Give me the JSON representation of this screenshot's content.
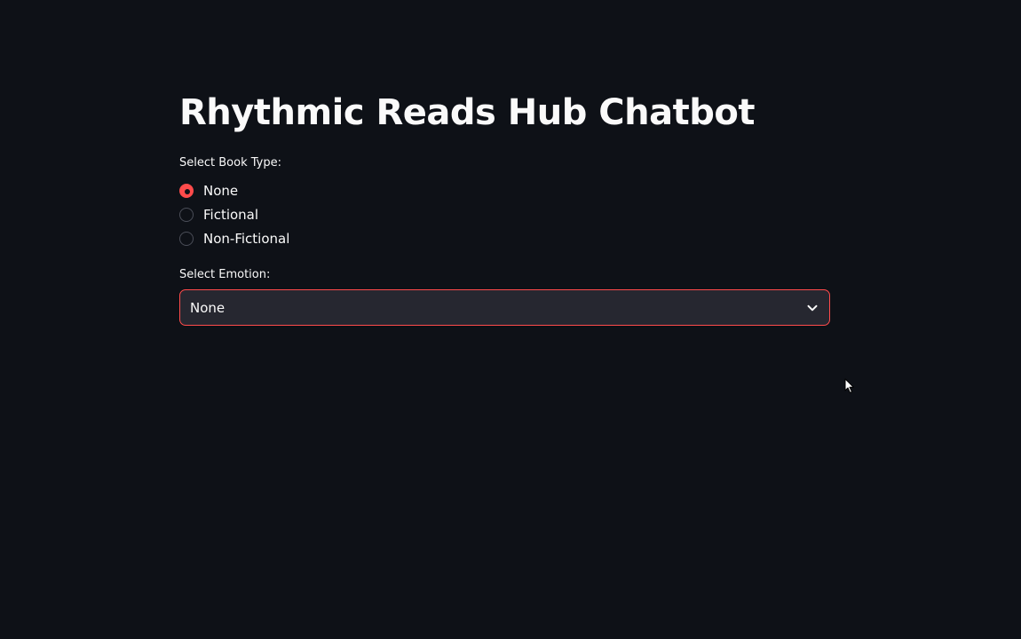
{
  "page": {
    "title": "Rhythmic Reads Hub Chatbot"
  },
  "book_type": {
    "label": "Select Book Type:",
    "options": [
      {
        "label": "None",
        "selected": true
      },
      {
        "label": "Fictional",
        "selected": false
      },
      {
        "label": "Non-Fictional",
        "selected": false
      }
    ]
  },
  "emotion": {
    "label": "Select Emotion:",
    "selected_value": "None",
    "icon": "chevron-down-icon"
  },
  "colors": {
    "background": "#0e1117",
    "accent": "#ff4b4b",
    "input_background": "#262730",
    "text": "#fafafa"
  }
}
